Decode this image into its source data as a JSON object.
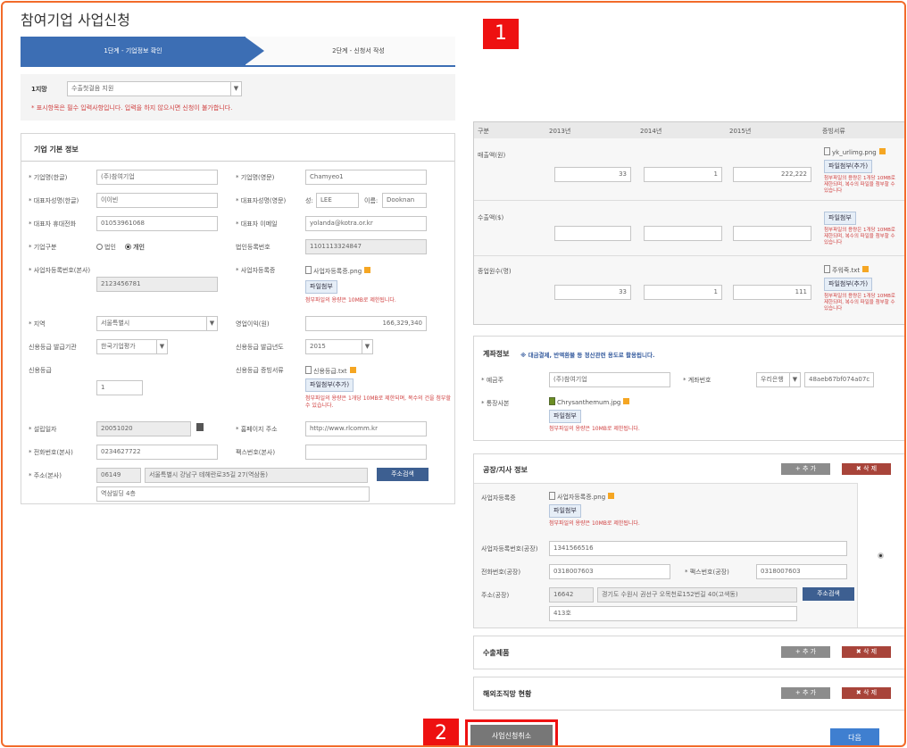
{
  "page_title": "참여기업 사업신청",
  "steps": {
    "step1": "1단계 - 기업정보 확인",
    "step2": "2단계 - 신청서 작성"
  },
  "choice": {
    "label": "1지망",
    "value": "수출첫걸음 지원"
  },
  "required_notice": "* 표시항목은 필수 입력사항입니다. 입력을 하지 않으시면 신청이 불가합니다.",
  "basic": {
    "title": "기업 기본 정보",
    "name_kr_label": "* 기업명(한글)",
    "name_kr": "(주)참여기업",
    "name_en_label": "* 기업명(영문)",
    "name_en": "Chamyeo1",
    "ceo_kr_label": "* 대표자성명(한글)",
    "ceo_kr": "이이빈",
    "ceo_en_label": "* 대표자성명(영문)",
    "ceo_first_label": "성:",
    "ceo_first": "LEE",
    "ceo_last_label": "이름:",
    "ceo_last": "Dooknan",
    "ceo_phone_label": "* 대표자 휴대전화",
    "ceo_phone": "01053961068",
    "ceo_email_label": "* 대표자 이메일",
    "ceo_email": "yolanda@kotra.or.kr",
    "type_label": "* 기업구분",
    "type_opt1": "법인",
    "type_opt2": "개인",
    "corp_no_label": "법인등록번호",
    "corp_no": "1101113324847",
    "biz_no_label": "* 사업자등록번호(본사)",
    "biz_no": "2123456781",
    "biz_cert_label": "* 사업자등록증",
    "biz_cert_file": "사업자등록증.png",
    "file_btn": "파일첨부",
    "file_note_10": "첨부파일의 용량은 10MB로 제한됩니다.",
    "region_label": "* 지역",
    "region": "서울특별시",
    "profit_label": "영업이익(원)",
    "profit": "166,329,340",
    "credit_org_label": "신용등급 발급기관",
    "credit_org": "한국기업평가",
    "credit_year_label": "신용등급 발급년도",
    "credit_year": "2015",
    "credit_grade_label": "신용등급",
    "credit_grade": "1",
    "credit_doc_label": "신용등급 증빙서류",
    "credit_doc_file": "신용등급.txt",
    "file_btn_add": "파일첨부(추가)",
    "credit_doc_note": "첨부파일의 용량은 1개당 10MB로 제한되며, 복수의 건을 첨부할 수 있습니다.",
    "found_label": "* 설립일자",
    "found": "20051020",
    "homepage_label": "* 홈페이지 주소",
    "homepage": "http://www.rlcomm.kr",
    "tel_label": "* 전화번호(본사)",
    "tel": "0234627722",
    "fax_label": "팩스번호(본사)",
    "fax": "",
    "addr_label": "* 주소(본사)",
    "zip": "06149",
    "addr1": "서울특별시 강남구 테헤란로35길 27(역삼동)",
    "addr2": "역삼빌딩 4층",
    "addr_btn": "주소검색"
  },
  "finance": {
    "headers": [
      "구분",
      "2013년",
      "2014년",
      "2015년",
      "증빙서류"
    ],
    "rows": [
      {
        "label": "매출액(원)",
        "v1": "33",
        "v2": "1",
        "v3": "222,222",
        "file": "yk_urlimg.png",
        "btn": "파일첨부(추가)",
        "note": "첨부파일의 용량은 1개당 10MB로 제한되며, 복수의 파일을 첨부할 수 있습니다"
      },
      {
        "label": "수출액($)",
        "v1": "",
        "v2": "",
        "v3": "",
        "file": "",
        "btn": "파일첨부",
        "note": "첨부파일의 용량은 1개당 10MB로 제한되며, 복수의 파일을 첨부할 수 있습니다"
      },
      {
        "label": "종업원수(명)",
        "v1": "33",
        "v2": "1",
        "v3": "111",
        "file": "주워죽.txt",
        "btn": "파일첨부(추가)",
        "note": "첨부파일의 용량은 1개당 10MB로 제한되며, 복수의 파일을 첨부할 수 있습니다"
      }
    ]
  },
  "account": {
    "title": "계좌정보",
    "note": "※ 대금결제, 반액환불 등 정산관련 용도로 활용됩니다.",
    "holder_label": "* 예금주",
    "holder": "(주)참여기업",
    "acct_label": "* 계좌번호",
    "bank": "우리은행",
    "acct": "48aeb67bf074a07c",
    "bankbook_label": "* 통장사본",
    "bankbook_file": "Chrysanthemum.jpg",
    "file_btn": "파일첨부",
    "note10": "첨부파일의 용량은 10MB로 제한됩니다."
  },
  "factory": {
    "title": "공장/지사 정보",
    "add": "+ 추 가",
    "del": "✖ 삭 제",
    "cert_label": "사업자등록증",
    "cert_file": "사업자등록증.png",
    "file_btn": "파일첨부",
    "note10": "첨부파일의 용량은 10MB로 제한됩니다.",
    "biz_no_label": "사업자등록번호(공장)",
    "biz_no": "1341566516",
    "tel_label": "전화번호(공장)",
    "tel": "0318007603",
    "fax_label": "* 팩스번호(공장)",
    "fax": "0318007603",
    "addr_label": "주소(공장)",
    "zip": "16642",
    "addr1": "경기도 수원시 권선구 오목천로152번길 40(고색동)",
    "addr2": "413호",
    "addr_btn": "주소검색"
  },
  "export_products": {
    "title": "수출제품",
    "add": "+ 추 가",
    "del": "✖ 삭 제"
  },
  "overseas": {
    "title": "해외조직망 현황",
    "add": "+ 추 가",
    "del": "✖ 삭 제"
  },
  "cancel_btn": "사업신청취소",
  "next_btn": "다음",
  "badges": {
    "one": "1",
    "two": "2"
  },
  "colors": {
    "step_active": "#3c6eb4",
    "badge": "#e11111",
    "frame": "#f26b2a",
    "delete": "#a8443a",
    "addr_btn": "#3d5f91",
    "next": "#3f7fd0"
  }
}
